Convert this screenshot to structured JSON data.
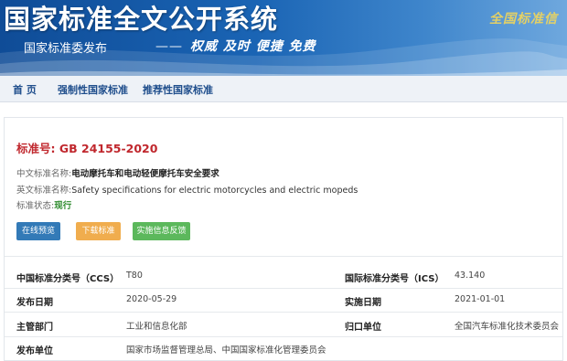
{
  "header": {
    "title": "国家标准全文公开系统",
    "subtitle": "国家标准委发布",
    "slogan_dash": "——",
    "slogan": "权威 及时 便捷 免费",
    "seal_text": "全国标准信"
  },
  "nav": {
    "items": [
      {
        "label": "首 页"
      },
      {
        "label": "强制性国家标准"
      },
      {
        "label": "推荐性国家标准"
      }
    ]
  },
  "standard": {
    "number": "标准号: GB 24155-2020",
    "cn_name_label": "中文标准名称:",
    "cn_name": "电动摩托车和电动轻便摩托车安全要求",
    "en_name_label": "英文标准名称:",
    "en_name": "Safety specifications for electric motorcycles and electric mopeds",
    "status_label": "标准状态:",
    "status": "现行"
  },
  "buttons": {
    "preview": {
      "label": "在线预览",
      "color": "#337ab7"
    },
    "download": {
      "label": "下载标准",
      "color": "#f0ad4e"
    },
    "feedback": {
      "label": "实施信息反馈",
      "color": "#5cb85c"
    }
  },
  "meta": {
    "ccs_label": "中国标准分类号（CCS）",
    "ccs_value": "T80",
    "ics_label": "国际标准分类号（ICS）",
    "ics_value": "43.140",
    "publish_date_label": "发布日期",
    "publish_date": "2020-05-29",
    "impl_date_label": "实施日期",
    "impl_date": "2021-01-01",
    "dept_label": "主管部门",
    "dept_value": "工业和信息化部",
    "owner_label": "归口单位",
    "owner_value": "全国汽车标准化技术委员会",
    "issuer_label": "发布单位",
    "issuer_value": "国家市场监督管理总局、中国国家标准化管理委员会"
  }
}
